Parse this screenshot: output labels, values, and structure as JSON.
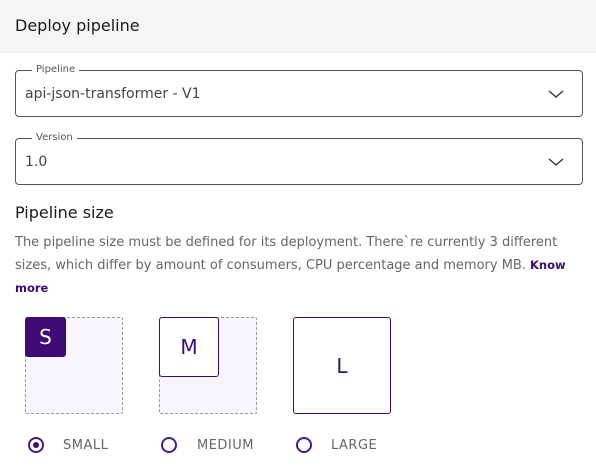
{
  "header": {
    "title": "Deploy pipeline"
  },
  "pipeline_field": {
    "label": "Pipeline",
    "value": "api-json-transformer - V1"
  },
  "version_field": {
    "label": "Version",
    "value": "1.0"
  },
  "size_section": {
    "title": "Pipeline size",
    "description": "The pipeline size must be defined for its deployment. There`re currently 3 different sizes, which differ by amount of consumers, CPU percentage and memory MB.",
    "link": "Know more",
    "options": [
      {
        "short": "S",
        "label": "SMALL",
        "selected": true
      },
      {
        "short": "M",
        "label": "MEDIUM",
        "selected": false
      },
      {
        "short": "L",
        "label": "LARGE",
        "selected": false
      }
    ]
  },
  "colors": {
    "accent": "#3e0a73",
    "header_bg": "#f5f5f5"
  }
}
